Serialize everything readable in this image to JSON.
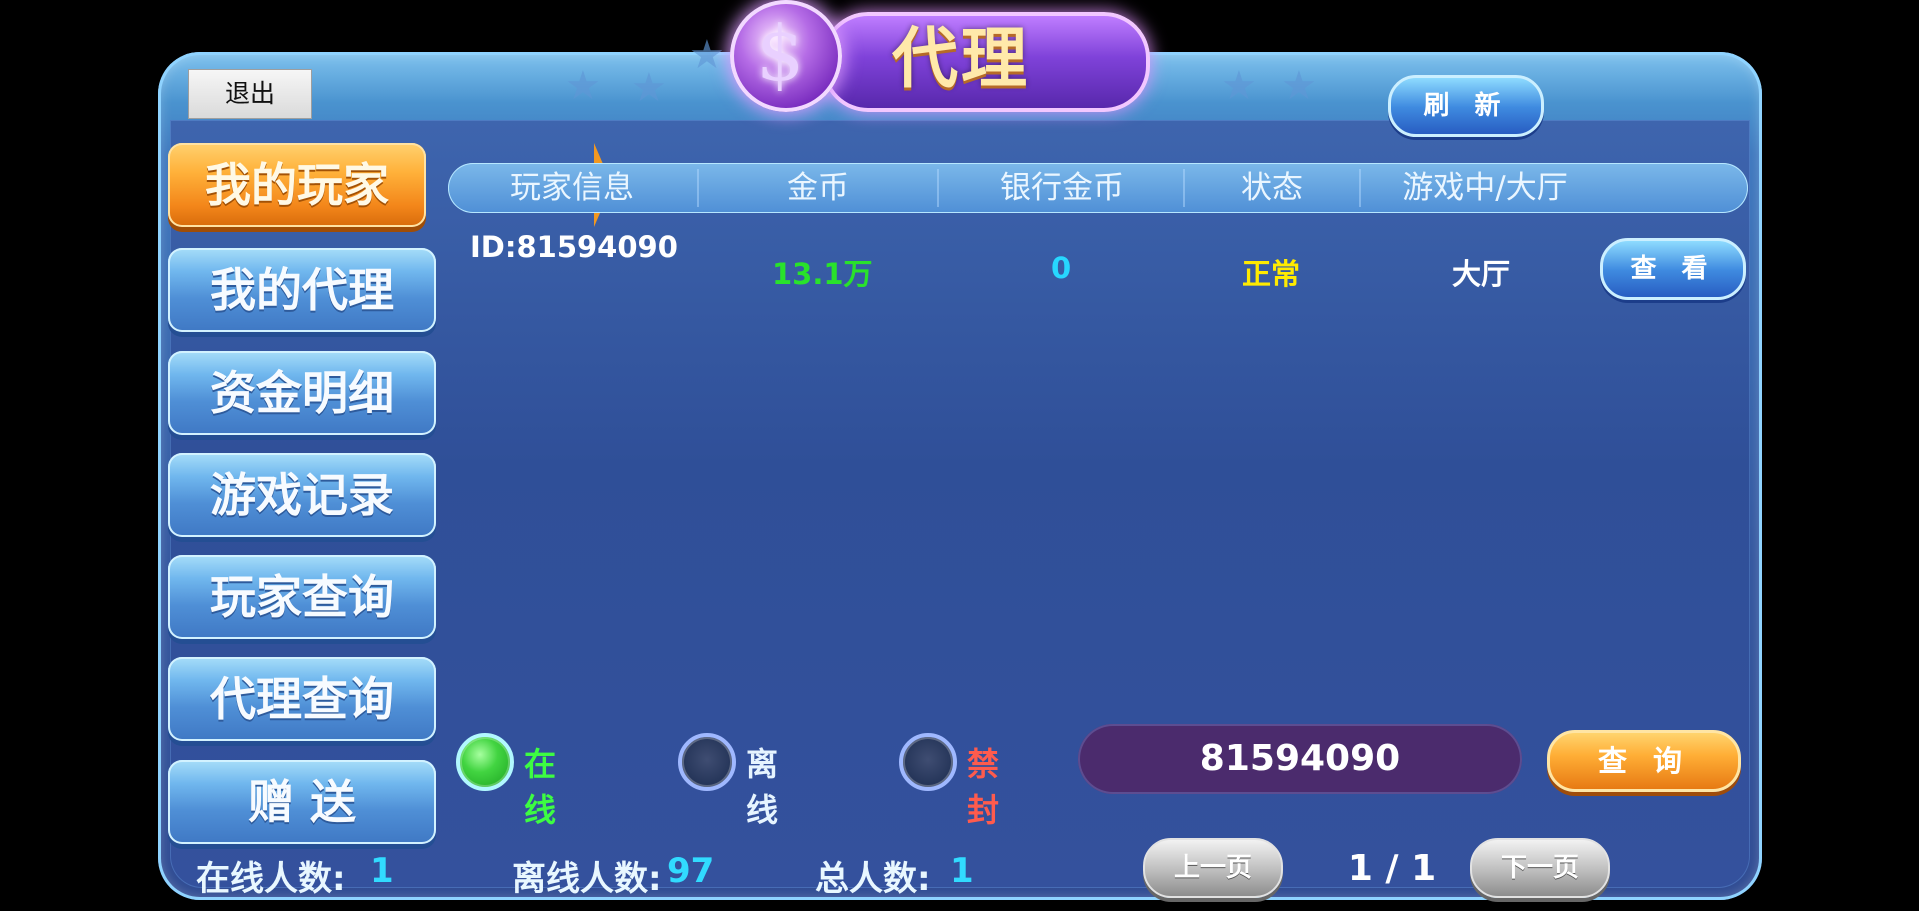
{
  "window": {
    "title": "代理",
    "logout_label": "退出",
    "refresh_label": "刷 新"
  },
  "sidebar": {
    "items": [
      {
        "label": "我的玩家",
        "active": true
      },
      {
        "label": "我的代理",
        "active": false
      },
      {
        "label": "资金明细",
        "active": false
      },
      {
        "label": "游戏记录",
        "active": false
      },
      {
        "label": "玩家查询",
        "active": false
      },
      {
        "label": "代理查询",
        "active": false
      },
      {
        "label": "赠 送",
        "active": false
      }
    ]
  },
  "table": {
    "headers": [
      "玩家信息",
      "金币",
      "银行金币",
      "状态",
      "游戏中/大厅"
    ],
    "rows": [
      {
        "player_info": "ID:81594090",
        "gold": "13.1万",
        "bank_gold": "0",
        "status": "正常",
        "location": "大厅",
        "action": "查 看"
      }
    ]
  },
  "filters": {
    "online": "在线",
    "offline": "离线",
    "banned": "禁封",
    "query_value": "81594090",
    "query_button": "查 询"
  },
  "footer": {
    "online_label": "在线人数:",
    "online_value": "1",
    "offline_label": "离线人数:",
    "offline_value": "97",
    "total_label": "总人数:",
    "total_value": "1",
    "prev_page": "上一页",
    "page_indicator": "1 / 1",
    "next_page": "下一页"
  },
  "colors": {
    "gold_text": "#29e22b",
    "bank_text": "#27d7ff",
    "status_text": "#ffeb00",
    "banned_text": "#ff5b4d"
  },
  "icons": {
    "title_logo": "dollar-sign-icon",
    "star_decoration": "star-icon"
  }
}
